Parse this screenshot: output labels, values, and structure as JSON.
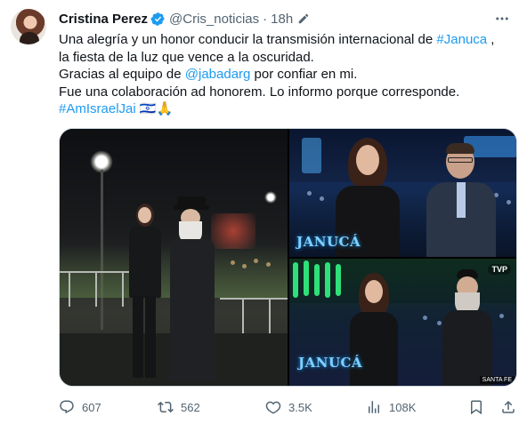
{
  "author": {
    "name": "Cristina Perez",
    "handle": "@Cris_noticias",
    "separator": "·",
    "time": "18h"
  },
  "tweet": {
    "line1_before": "Una alegría y un honor conducir la transmisión internacional de ",
    "line1_hashtag": "#Januca",
    "line1_after": " ,",
    "line2": "la fiesta de la luz que vence a la oscuridad.",
    "line3_before": "Gracias al equipo de ",
    "line3_mention": "@jabadarg",
    "line3_after": " por confiar en mi.",
    "line4": " Fue una colaboración ad honorem. Lo informo porque corresponde.",
    "line5_hashtag": "#AmIsraelJai",
    "line5_emoji": " 🇮🇱🙏"
  },
  "media": {
    "tr_logo": "JANUCÁ",
    "br_logo": "JANUCÁ",
    "br_bug": "TVP",
    "br_lower": "SANTA FE"
  },
  "actions": {
    "replies": "607",
    "retweets": "562",
    "likes": "3.5K",
    "views": "108K"
  },
  "colors": {
    "link": "#1d9bf0",
    "secondary": "#536471",
    "verified": "#1d9bf0"
  },
  "icons": [
    "verified-badge-icon",
    "edit-icon",
    "more-icon",
    "reply-icon",
    "retweet-icon",
    "like-icon",
    "views-icon",
    "bookmark-icon",
    "share-icon"
  ]
}
